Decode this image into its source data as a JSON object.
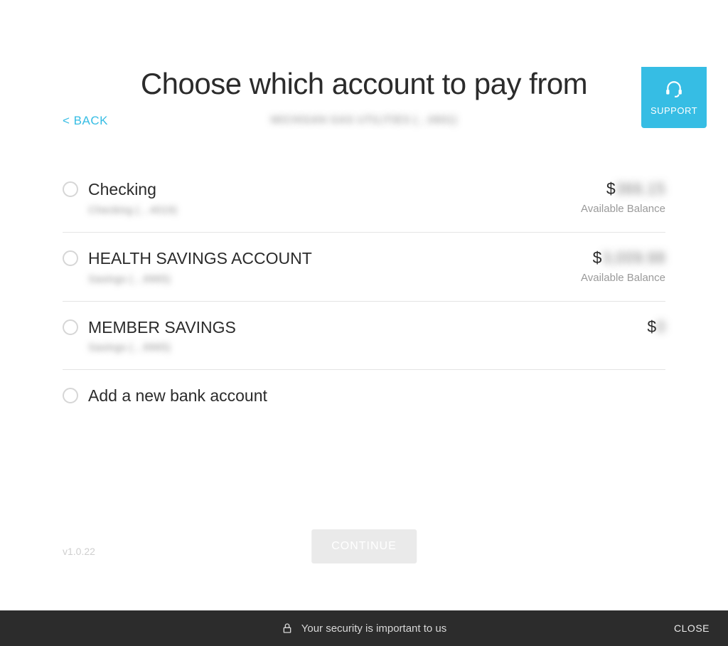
{
  "support": {
    "label": "SUPPORT"
  },
  "back_label": "< BACK",
  "merchant_obscured": "MICHIGAN GAS UTILITIES (…0601)",
  "page_title": "Choose which account to pay from",
  "accounts": [
    {
      "name": "Checking",
      "sub_obscured": "Checking (…4019)",
      "currency": "$",
      "amount_obscured": "366.15",
      "balance_label": "Available Balance"
    },
    {
      "name": "HEALTH SAVINGS ACCOUNT",
      "sub_obscured": "Savings (…9965)",
      "currency": "$",
      "amount_obscured": "3,009.98",
      "balance_label": "Available Balance"
    },
    {
      "name": "MEMBER SAVINGS",
      "sub_obscured": "Savings (…9965)",
      "currency": "$",
      "amount_obscured": "0",
      "balance_label": ""
    }
  ],
  "add_new_label": "Add a new bank account",
  "continue_label": "CONTINUE",
  "version": "v1.0.22",
  "footer": {
    "security_text": "Your security is important to us",
    "close_label": "CLOSE"
  }
}
